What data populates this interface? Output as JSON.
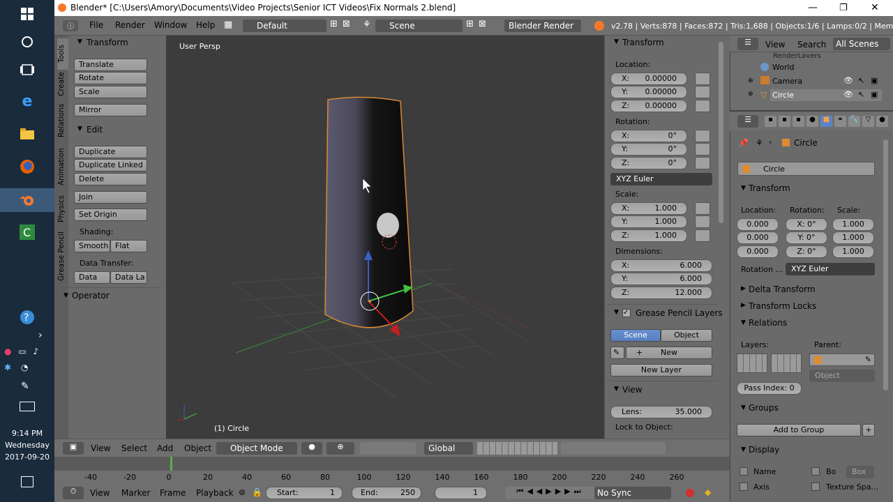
{
  "window": {
    "title": "Blender* [C:\\Users\\Amory\\Documents\\Video Projects\\Senior ICT Videos\\Fix Normals 2.blend]"
  },
  "taskbar": {
    "time": "9:14 PM",
    "day": "Wednesday",
    "date": "2017-09-20"
  },
  "menu": {
    "file": "File",
    "render": "Render",
    "window": "Window",
    "help": "Help",
    "layout": "Default",
    "scene": "Scene",
    "engine": "Blender Render",
    "stats": "v2.78 | Verts:878 | Faces:872 | Tris:1,688 | Objects:1/6 | Lamps:0/2 | Mem:26"
  },
  "tool_tabs": [
    "Tools",
    "Create",
    "Relations",
    "Animation",
    "Physics",
    "Grease Pencil"
  ],
  "tools": {
    "transform_header": "Transform",
    "translate": "Translate",
    "rotate": "Rotate",
    "scale": "Scale",
    "mirror": "Mirror",
    "edit_header": "Edit",
    "duplicate": "Duplicate",
    "duplicate_linked": "Duplicate Linked",
    "delete": "Delete",
    "join": "Join",
    "set_origin": "Set Origin",
    "shading_label": "Shading:",
    "smooth": "Smooth",
    "flat": "Flat",
    "data_transfer_label": "Data Transfer:",
    "data": "Data",
    "data_la": "Data La",
    "operator_header": "Operator"
  },
  "viewport": {
    "view_name": "User Persp",
    "object_label": "(1) Circle"
  },
  "properties_n": {
    "transform_header": "Transform",
    "location_label": "Location:",
    "loc_x": "0.00000",
    "loc_y": "0.00000",
    "loc_z": "0.00000",
    "rotation_label": "Rotation:",
    "rot_x": "0°",
    "rot_y": "0°",
    "rot_z": "0°",
    "rotation_mode": "XYZ Euler",
    "scale_label": "Scale:",
    "scale_x": "1.000",
    "scale_y": "1.000",
    "scale_z": "1.000",
    "dimensions_label": "Dimensions:",
    "dim_x": "6.000",
    "dim_y": "6.000",
    "dim_z": "12.000",
    "gp_header": "Grease Pencil Layers",
    "gp_scene": "Scene",
    "gp_object": "Object",
    "gp_new": "New",
    "gp_new_layer": "New Layer",
    "view_header": "View",
    "lens_label": "Lens:",
    "lens_value": "35.000",
    "lock_label": "Lock to Object:"
  },
  "outliner": {
    "view": "View",
    "search": "Search",
    "all_scenes": "All Scenes",
    "items": [
      "RenderLayers",
      "World",
      "Camera",
      "Circle"
    ]
  },
  "object_props": {
    "breadcrumb": "Circle",
    "name": "Circle",
    "transform_header": "Transform",
    "location_label": "Location:",
    "rotation_label": "Rotation:",
    "scale_label": "Scale:",
    "loc": [
      "0.000",
      "0.000",
      "0.000"
    ],
    "rot": [
      "X: 0°",
      "Y: 0°",
      "Z: 0°"
    ],
    "scale": [
      "1.000",
      "1.000",
      "1.000"
    ],
    "rotation_mode_label": "Rotation ...",
    "rotation_mode": "XYZ Euler",
    "delta_transform": "Delta Transform",
    "transform_locks": "Transform Locks",
    "relations": "Relations",
    "layers_label": "Layers:",
    "parent_label": "Parent:",
    "parent_type": "Object",
    "pass_index": "Pass Index: 0",
    "groups": "Groups",
    "add_to_group": "Add to Group",
    "display": "Display",
    "display_name": "Name",
    "display_axis": "Axis",
    "display_bo": "Bo",
    "display_box": "Box",
    "display_texture": "Texture Spa..."
  },
  "viewport_header": {
    "view": "View",
    "select": "Select",
    "add": "Add",
    "object": "Object",
    "mode": "Object Mode",
    "orientation": "Global"
  },
  "timeline": {
    "ticks": [
      "-40",
      "-20",
      "0",
      "20",
      "40",
      "60",
      "80",
      "100",
      "120",
      "140",
      "160",
      "180",
      "200",
      "220",
      "240",
      "260"
    ],
    "view": "View",
    "marker": "Marker",
    "frame": "Frame",
    "playback": "Playback",
    "start_label": "Start:",
    "start_value": "1",
    "end_label": "End:",
    "end_value": "250",
    "current_frame": "1",
    "sync": "No Sync"
  }
}
